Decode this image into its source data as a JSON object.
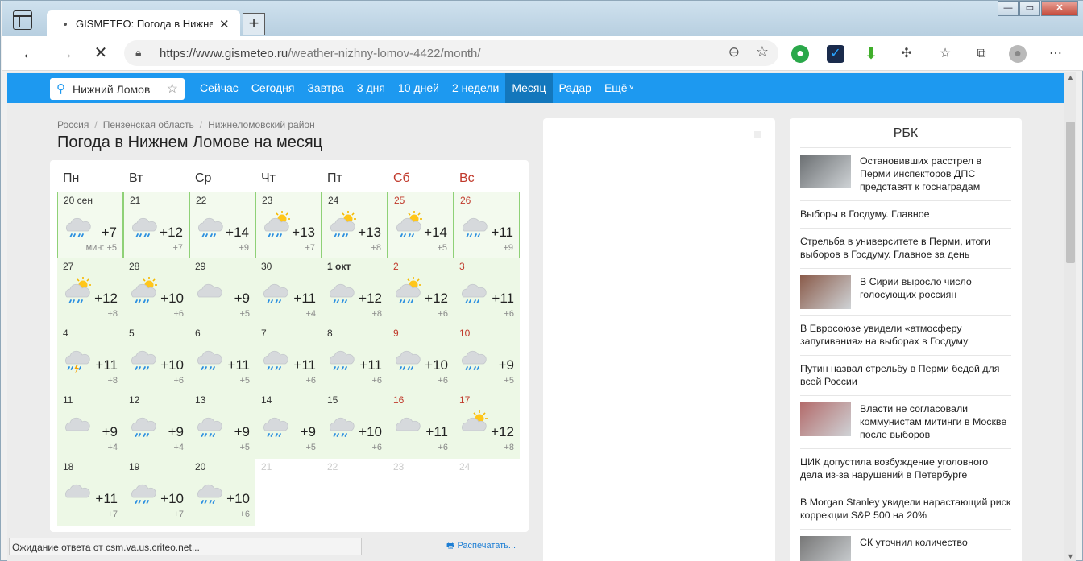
{
  "browser": {
    "tab_title": "GISMETEO: Погода в Нижнем Л",
    "tab_close": "✕",
    "new_tab": "+",
    "url_host": "https://www.gismeteo.ru",
    "url_path": "/weather-nizhny-lomov-4422/month/",
    "win_min": "—",
    "win_max": "▭",
    "win_close": "✕"
  },
  "site_nav": {
    "search_value": "Нижний Ломов",
    "links": [
      "Сейчас",
      "Сегодня",
      "Завтра",
      "3 дня",
      "10 дней",
      "2 недели",
      "Месяц",
      "Радар",
      "Ещё"
    ],
    "more_caret": "˅",
    "active_index": 6
  },
  "breadcrumbs": [
    "Россия",
    "Пензенская область",
    "Нижнеломовский район"
  ],
  "breadcrumb_sep": "/",
  "page_title": "Погода в Нижнем Ломове на месяц",
  "weekdays": [
    "Пн",
    "Вт",
    "Ср",
    "Чт",
    "Пт",
    "Сб",
    "Вс"
  ],
  "days": [
    {
      "d": "20 сен",
      "max": "+7",
      "min": "мин: +5",
      "icon": "cloud-rain-icon"
    },
    {
      "d": "21",
      "max": "+12",
      "min": "+7",
      "icon": "cloud-rain-icon"
    },
    {
      "d": "22",
      "max": "+14",
      "min": "+9",
      "icon": "cloud-rain-icon"
    },
    {
      "d": "23",
      "max": "+13",
      "min": "+7",
      "icon": "sun-cloud-rain-icon"
    },
    {
      "d": "24",
      "max": "+13",
      "min": "+8",
      "icon": "sun-cloud-rain-icon"
    },
    {
      "d": "25",
      "max": "+14",
      "min": "+5",
      "icon": "sun-cloud-rain-icon"
    },
    {
      "d": "26",
      "max": "+11",
      "min": "+9",
      "icon": "cloud-rain-icon"
    },
    {
      "d": "27",
      "max": "+12",
      "min": "+8",
      "icon": "sun-cloud-rain-icon"
    },
    {
      "d": "28",
      "max": "+10",
      "min": "+6",
      "icon": "sun-cloud-rain-icon"
    },
    {
      "d": "29",
      "max": "+9",
      "min": "+5",
      "icon": "cloud-icon"
    },
    {
      "d": "30",
      "max": "+11",
      "min": "+4",
      "icon": "cloud-rain-icon"
    },
    {
      "d": "1 окт",
      "max": "+12",
      "min": "+8",
      "icon": "cloud-rain-icon"
    },
    {
      "d": "2",
      "max": "+12",
      "min": "+6",
      "icon": "sun-cloud-rain-icon"
    },
    {
      "d": "3",
      "max": "+11",
      "min": "+6",
      "icon": "cloud-rain-icon"
    },
    {
      "d": "4",
      "max": "+11",
      "min": "+8",
      "icon": "cloud-storm-icon"
    },
    {
      "d": "5",
      "max": "+10",
      "min": "+6",
      "icon": "cloud-rain-icon"
    },
    {
      "d": "6",
      "max": "+11",
      "min": "+5",
      "icon": "cloud-rain-icon"
    },
    {
      "d": "7",
      "max": "+11",
      "min": "+6",
      "icon": "cloud-rain-icon"
    },
    {
      "d": "8",
      "max": "+11",
      "min": "+6",
      "icon": "cloud-rain-icon"
    },
    {
      "d": "9",
      "max": "+10",
      "min": "+6",
      "icon": "cloud-rain-icon"
    },
    {
      "d": "10",
      "max": "+9",
      "min": "+5",
      "icon": "cloud-rain-icon"
    },
    {
      "d": "11",
      "max": "+9",
      "min": "+4",
      "icon": "cloud-icon"
    },
    {
      "d": "12",
      "max": "+9",
      "min": "+4",
      "icon": "cloud-rain-icon"
    },
    {
      "d": "13",
      "max": "+9",
      "min": "+5",
      "icon": "cloud-rain-icon"
    },
    {
      "d": "14",
      "max": "+9",
      "min": "+5",
      "icon": "cloud-rain-icon"
    },
    {
      "d": "15",
      "max": "+10",
      "min": "+6",
      "icon": "cloud-rain-icon"
    },
    {
      "d": "16",
      "max": "+11",
      "min": "+6",
      "icon": "cloud-icon"
    },
    {
      "d": "17",
      "max": "+12",
      "min": "+8",
      "icon": "sun-cloud-icon"
    },
    {
      "d": "18",
      "max": "+11",
      "min": "+7",
      "icon": "cloud-icon"
    },
    {
      "d": "19",
      "max": "+10",
      "min": "+7",
      "icon": "cloud-rain-icon"
    },
    {
      "d": "20",
      "max": "+10",
      "min": "+6",
      "icon": "cloud-rain-icon"
    },
    {
      "d": "21",
      "max": "",
      "min": "",
      "icon": ""
    },
    {
      "d": "22",
      "max": "",
      "min": "",
      "icon": ""
    },
    {
      "d": "23",
      "max": "",
      "min": "",
      "icon": ""
    },
    {
      "d": "24",
      "max": "",
      "min": "",
      "icon": ""
    }
  ],
  "print_label": "Распечатать...",
  "status_text": "Ожидание ответа от csm.va.us.criteo.net...",
  "news": {
    "title": "РБК",
    "items": [
      {
        "text": "Остановивших расстрел в Перми инспекторов ДПС представят к госнаградам",
        "thumb": true,
        "thumb_color": "#6b6f72"
      },
      {
        "text": "Выборы в Госдуму. Главное",
        "thumb": false
      },
      {
        "text": "Стрельба в университете в Перми, итоги выборов в Госдуму. Главное за день",
        "thumb": false
      },
      {
        "text": "В Сирии выросло число голосующих россиян",
        "thumb": true,
        "thumb_color": "#8a5b4a"
      },
      {
        "text": "В Евросоюзе увидели «атмосферу запугивания» на выборах в Госдуму",
        "thumb": false
      },
      {
        "text": "Путин назвал стрельбу в Перми бедой для всей России",
        "thumb": false
      },
      {
        "text": "Власти не согласовали коммунистам митинги в Москве после выборов",
        "thumb": true,
        "thumb_color": "#b36b6b"
      },
      {
        "text": "ЦИК допустила возбуждение уголовного дела из-за нарушений в Петербурге",
        "thumb": false
      },
      {
        "text": "В Morgan Stanley увидели нарастающий риск коррекции S&P 500 на 20%",
        "thumb": false
      },
      {
        "text": "СК уточнил количество",
        "thumb": true,
        "thumb_color": "#777777"
      }
    ]
  },
  "colors": {
    "nav_blue": "#1d99f0",
    "weekend_red": "#c0392b",
    "cell_green": "#edf8e6"
  }
}
